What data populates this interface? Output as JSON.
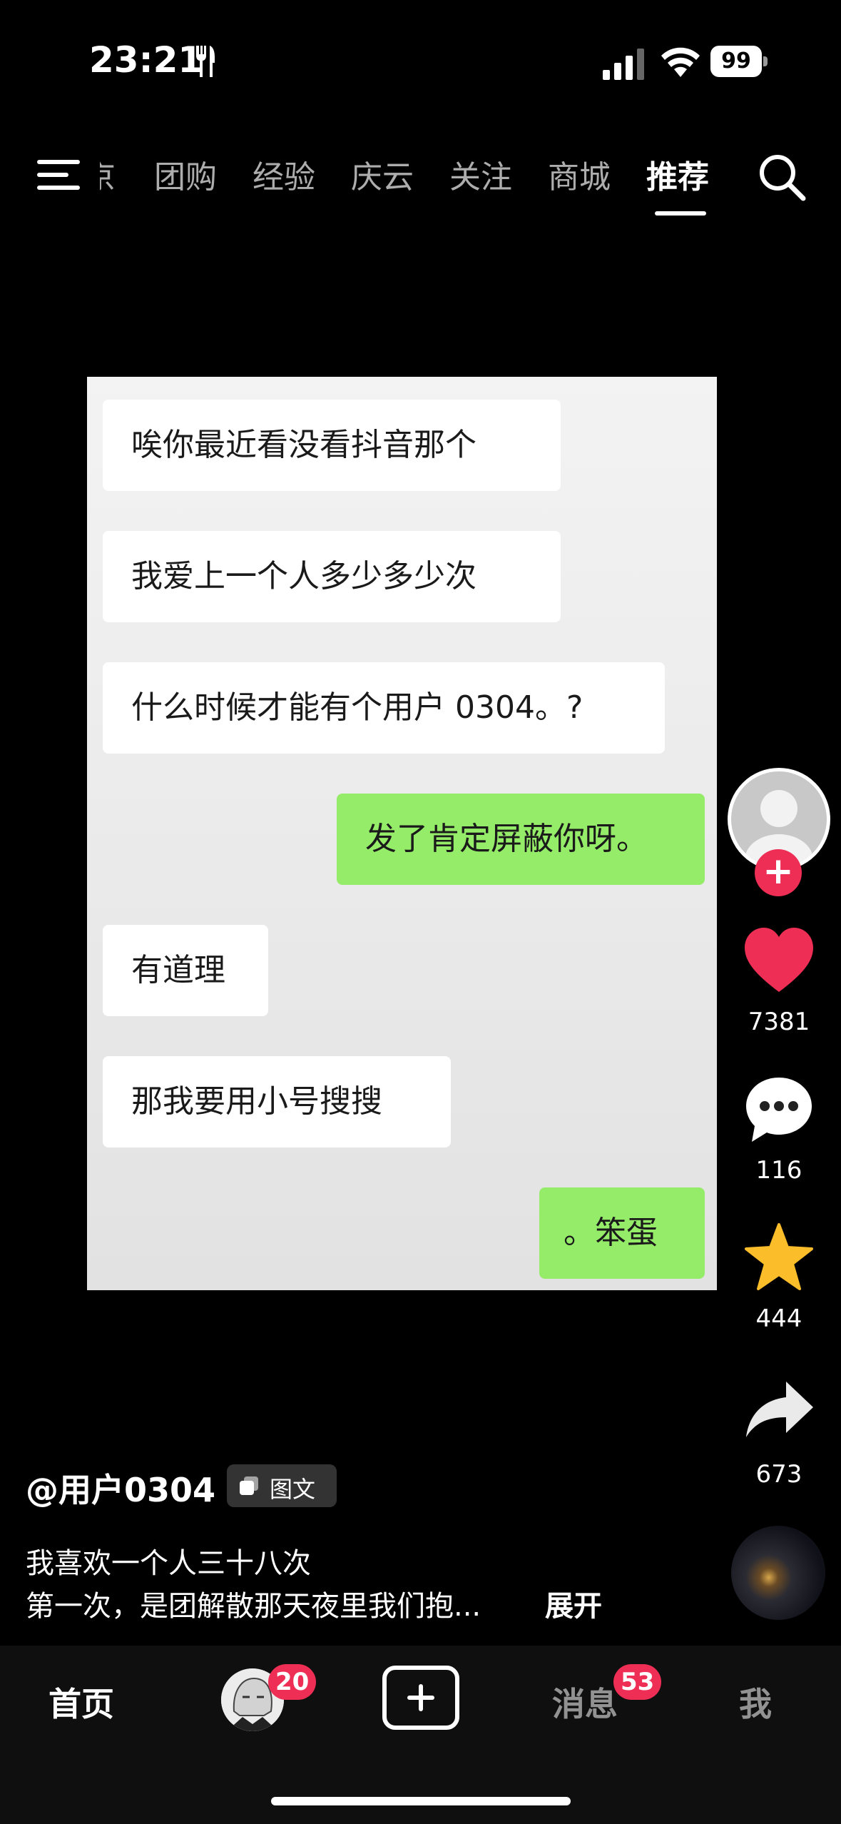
{
  "status_bar": {
    "time": "23:21",
    "battery": "99",
    "icons": [
      "fork-knife-icon",
      "signal-icon",
      "wifi-icon",
      "battery-icon"
    ]
  },
  "top_nav": {
    "partial_tab": "京",
    "tabs": [
      "团购",
      "经验",
      "庆云",
      "关注",
      "商城",
      "推荐"
    ],
    "active_tab": "推荐"
  },
  "chat": {
    "messages": [
      {
        "side": "in",
        "text": "唉你最近看没看抖音那个"
      },
      {
        "side": "in",
        "text": "我爱上一个人多少多少次"
      },
      {
        "side": "in",
        "text": "什么时候才能有个用户 0304。?"
      },
      {
        "side": "out",
        "text": "发了肯定屏蔽你呀。"
      },
      {
        "side": "in",
        "text": "有道理"
      },
      {
        "side": "in",
        "text": "那我要用小号搜搜"
      },
      {
        "side": "out",
        "text": "。笨蛋"
      }
    ],
    "colors": {
      "incoming": "#ffffff",
      "outgoing": "#95ec69"
    }
  },
  "right_rail": {
    "like_count": "7381",
    "comment_count": "116",
    "favorite_count": "444",
    "share_count": "673",
    "colors": {
      "like": "#ee2e55",
      "favorite": "#fbbd2a",
      "follow": "#ee2e55"
    }
  },
  "post": {
    "author": "@用户0304",
    "type_badge": "图文",
    "caption_line1": "我喜欢一个人三十八次",
    "caption_line2": "第一次，是团解散那天夜里我们抱...",
    "expand_label": "展开"
  },
  "bottom_nav": {
    "home": "首页",
    "friends_badge": "20",
    "messages": "消息",
    "messages_badge": "53",
    "me": "我"
  }
}
